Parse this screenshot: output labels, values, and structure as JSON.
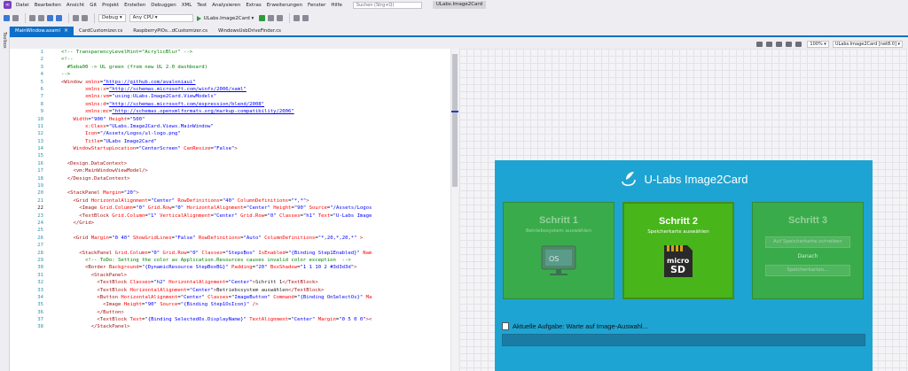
{
  "menu": {
    "items": [
      "Datei",
      "Bearbeiten",
      "Ansicht",
      "Git",
      "Projekt",
      "Erstellen",
      "Debuggen",
      "XML",
      "Test",
      "Analysieren",
      "Extras",
      "Erweiterungen",
      "Fenster",
      "Hilfe"
    ],
    "search_placeholder": "Suchen (Strg+Q)",
    "project_name": "ULabs.Image2Card"
  },
  "toolbar": {
    "config": "Debug",
    "platform": "Any CPU",
    "run_target": "ULabs.Image2Card"
  },
  "toolbox_label": "Toolbox",
  "tabs": [
    {
      "label": "MainWindow.axaml",
      "active": true
    },
    {
      "label": "CardCustomizer.cs",
      "active": false
    },
    {
      "label": "RaspberryPiOs...dCustomizer.cs",
      "active": false
    },
    {
      "label": "WindowsUsbDriveFinder.cs",
      "active": false
    }
  ],
  "designer_toolbar": {
    "zoom": "100%",
    "target": "ULabs.Image2Card [net8.0]"
  },
  "code_lines": [
    {
      "n": "1",
      "segs": [
        [
          "com",
          "<!-- TransparencyLevelHint=\"AcrylicBlur\" -->"
        ]
      ]
    },
    {
      "n": "2",
      "segs": [
        [
          "com",
          "<!--"
        ]
      ]
    },
    {
      "n": "3",
      "segs": [
        [
          "com",
          "  #5eba00 -> UL green (from new UL 2.0 dashboard)"
        ]
      ]
    },
    {
      "n": "4",
      "segs": [
        [
          "com",
          "-->"
        ]
      ]
    },
    {
      "n": "5",
      "segs": [
        [
          "tag",
          "<Window "
        ],
        [
          "attr",
          "xmlns"
        ],
        [
          "txt",
          "="
        ],
        [
          "url",
          "\"https://github.com/avaloniaui\""
        ]
      ]
    },
    {
      "n": "6",
      "segs": [
        [
          "txt",
          "        "
        ],
        [
          "attr",
          "xmlns:x"
        ],
        [
          "txt",
          "="
        ],
        [
          "url",
          "\"http://schemas.microsoft.com/winfx/2006/xaml\""
        ]
      ]
    },
    {
      "n": "7",
      "segs": [
        [
          "txt",
          "        "
        ],
        [
          "attr",
          "xmlns:vm"
        ],
        [
          "txt",
          "="
        ],
        [
          "val",
          "\"using:ULabs.Image2Card.ViewModels\""
        ]
      ]
    },
    {
      "n": "8",
      "segs": [
        [
          "txt",
          "        "
        ],
        [
          "attr",
          "xmlns:d"
        ],
        [
          "txt",
          "="
        ],
        [
          "url",
          "\"http://schemas.microsoft.com/expression/blend/2008\""
        ]
      ]
    },
    {
      "n": "9",
      "segs": [
        [
          "txt",
          "        "
        ],
        [
          "attr",
          "xmlns:mc"
        ],
        [
          "txt",
          "="
        ],
        [
          "url",
          "\"http://schemas.openxmlformats.org/markup-compatibility/2006\""
        ]
      ]
    },
    {
      "n": "10",
      "segs": [
        [
          "txt",
          "    "
        ],
        [
          "attr",
          "Width"
        ],
        [
          "txt",
          "="
        ],
        [
          "val",
          "\"900\""
        ],
        [
          "txt",
          " "
        ],
        [
          "attr",
          "Height"
        ],
        [
          "txt",
          "="
        ],
        [
          "val",
          "\"500\""
        ]
      ]
    },
    {
      "n": "11",
      "segs": [
        [
          "txt",
          "        "
        ],
        [
          "attr",
          "x:Class"
        ],
        [
          "txt",
          "="
        ],
        [
          "val",
          "\"ULabs.Image2Card.Views.MainWindow\""
        ]
      ]
    },
    {
      "n": "12",
      "segs": [
        [
          "txt",
          "        "
        ],
        [
          "attr",
          "Icon"
        ],
        [
          "txt",
          "="
        ],
        [
          "val",
          "\"/Assets/Logos/ul-logo.png\""
        ]
      ]
    },
    {
      "n": "13",
      "segs": [
        [
          "txt",
          "        "
        ],
        [
          "attr",
          "Title"
        ],
        [
          "txt",
          "="
        ],
        [
          "val",
          "\"ULabs Image2Card\""
        ]
      ]
    },
    {
      "n": "14",
      "segs": [
        [
          "txt",
          "    "
        ],
        [
          "attr",
          "WindowStartupLocation"
        ],
        [
          "txt",
          "="
        ],
        [
          "val",
          "\"CenterScreen\""
        ],
        [
          "txt",
          " "
        ],
        [
          "attr",
          "CanResize"
        ],
        [
          "txt",
          "="
        ],
        [
          "val",
          "\"False\""
        ],
        [
          "tag",
          ">"
        ]
      ]
    },
    {
      "n": "15",
      "segs": []
    },
    {
      "n": "16",
      "segs": [
        [
          "txt",
          "  "
        ],
        [
          "tag",
          "<Design.DataContext>"
        ]
      ]
    },
    {
      "n": "17",
      "segs": [
        [
          "txt",
          "    "
        ],
        [
          "tag",
          "<vm:MainWindowViewModel/>"
        ]
      ]
    },
    {
      "n": "18",
      "segs": [
        [
          "txt",
          "  "
        ],
        [
          "tag",
          "</Design.DataContext>"
        ]
      ]
    },
    {
      "n": "19",
      "segs": []
    },
    {
      "n": "20",
      "segs": [
        [
          "txt",
          "  "
        ],
        [
          "tag",
          "<StackPanel "
        ],
        [
          "attr",
          "Margin"
        ],
        [
          "txt",
          "="
        ],
        [
          "val",
          "\"20\""
        ],
        [
          "tag",
          ">"
        ]
      ]
    },
    {
      "n": "21",
      "segs": [
        [
          "txt",
          "    "
        ],
        [
          "tag",
          "<Grid "
        ],
        [
          "attr",
          "HorizontalAlignment"
        ],
        [
          "txt",
          "="
        ],
        [
          "val",
          "\"Center\""
        ],
        [
          "txt",
          " "
        ],
        [
          "attr",
          "RowDefinitions"
        ],
        [
          "txt",
          "="
        ],
        [
          "val",
          "\"40\""
        ],
        [
          "txt",
          " "
        ],
        [
          "attr",
          "ColumnDefinitions"
        ],
        [
          "txt",
          "="
        ],
        [
          "val",
          "\"*,*\""
        ],
        [
          "tag",
          ">"
        ]
      ]
    },
    {
      "n": "22",
      "cur": true,
      "segs": [
        [
          "txt",
          "      "
        ],
        [
          "tag",
          "<Image "
        ],
        [
          "attr",
          "Grid.Column"
        ],
        [
          "txt",
          "="
        ],
        [
          "val",
          "\"0\""
        ],
        [
          "txt",
          " "
        ],
        [
          "attr",
          "Grid.Row"
        ],
        [
          "txt",
          "="
        ],
        [
          "val",
          "\"0\""
        ],
        [
          "txt",
          " "
        ],
        [
          "attr",
          "HorizontalAlignment"
        ],
        [
          "txt",
          "="
        ],
        [
          "val",
          "\"Center\""
        ],
        [
          "txt",
          " "
        ],
        [
          "attr",
          "Height"
        ],
        [
          "txt",
          "="
        ],
        [
          "val",
          "\"90\""
        ],
        [
          "txt",
          " "
        ],
        [
          "attr",
          "Source"
        ],
        [
          "txt",
          "="
        ],
        [
          "val",
          "\"/Assets/Logos"
        ]
      ]
    },
    {
      "n": "23",
      "segs": [
        [
          "txt",
          "      "
        ],
        [
          "tag",
          "<TextBlock "
        ],
        [
          "attr",
          "Grid.Column"
        ],
        [
          "txt",
          "="
        ],
        [
          "val",
          "\"1\""
        ],
        [
          "txt",
          " "
        ],
        [
          "attr",
          "VerticalAlignment"
        ],
        [
          "txt",
          "="
        ],
        [
          "val",
          "\"Center\""
        ],
        [
          "txt",
          " "
        ],
        [
          "attr",
          "Grid.Row"
        ],
        [
          "txt",
          "="
        ],
        [
          "val",
          "\"0\""
        ],
        [
          "txt",
          " "
        ],
        [
          "attr",
          "Classes"
        ],
        [
          "txt",
          "="
        ],
        [
          "val",
          "\"h1\""
        ],
        [
          "txt",
          " "
        ],
        [
          "attr",
          "Text"
        ],
        [
          "txt",
          "="
        ],
        [
          "val",
          "\"U-Labs Image"
        ]
      ]
    },
    {
      "n": "24",
      "segs": [
        [
          "txt",
          "    "
        ],
        [
          "tag",
          "</Grid>"
        ]
      ]
    },
    {
      "n": "25",
      "segs": []
    },
    {
      "n": "26",
      "segs": [
        [
          "txt",
          "    "
        ],
        [
          "tag",
          "<Grid "
        ],
        [
          "attr",
          "Margin"
        ],
        [
          "txt",
          "="
        ],
        [
          "val",
          "\"0 40\""
        ],
        [
          "txt",
          " "
        ],
        [
          "attr",
          "ShowGridLines"
        ],
        [
          "txt",
          "="
        ],
        [
          "val",
          "\"False\""
        ],
        [
          "txt",
          " "
        ],
        [
          "attr",
          "RowDefinitions"
        ],
        [
          "txt",
          "="
        ],
        [
          "val",
          "\"Auto\""
        ],
        [
          "txt",
          " "
        ],
        [
          "attr",
          "ColumnDefinitions"
        ],
        [
          "txt",
          "="
        ],
        [
          "val",
          "\"*,20,*,20,*\""
        ],
        [
          "tag",
          " >"
        ]
      ]
    },
    {
      "n": "27",
      "segs": []
    },
    {
      "n": "28",
      "segs": [
        [
          "txt",
          "      "
        ],
        [
          "tag",
          "<StackPanel "
        ],
        [
          "attr",
          "Grid.Column"
        ],
        [
          "txt",
          "="
        ],
        [
          "val",
          "\"0\""
        ],
        [
          "txt",
          " "
        ],
        [
          "attr",
          "Grid.Row"
        ],
        [
          "txt",
          "="
        ],
        [
          "val",
          "\"0\""
        ],
        [
          "txt",
          " "
        ],
        [
          "attr",
          "Classes"
        ],
        [
          "txt",
          "="
        ],
        [
          "val",
          "\"StepsBox\""
        ],
        [
          "txt",
          " "
        ],
        [
          "attr",
          "IsEnabled"
        ],
        [
          "txt",
          "="
        ],
        [
          "val",
          "\"{Binding Step1Enabled}\""
        ],
        [
          "txt",
          " "
        ],
        [
          "attr",
          "Nam"
        ]
      ]
    },
    {
      "n": "29",
      "segs": [
        [
          "txt",
          "        "
        ],
        [
          "com",
          "<!-- ToDo: Setting the color as Application.Resources causes invalid color exception  -->"
        ]
      ]
    },
    {
      "n": "30",
      "segs": [
        [
          "txt",
          "        "
        ],
        [
          "tag",
          "<Border "
        ],
        [
          "attr",
          "Background"
        ],
        [
          "txt",
          "="
        ],
        [
          "val",
          "\"{DynamicResource StepBoxBG}\""
        ],
        [
          "txt",
          " "
        ],
        [
          "attr",
          "Padding"
        ],
        [
          "txt",
          "="
        ],
        [
          "val",
          "\"20\""
        ],
        [
          "txt",
          " "
        ],
        [
          "attr",
          "BoxShadow"
        ],
        [
          "txt",
          "="
        ],
        [
          "val",
          "\"1 1 10 2 #3d3d3d\""
        ],
        [
          "tag",
          ">"
        ]
      ]
    },
    {
      "n": "31",
      "segs": [
        [
          "txt",
          "          "
        ],
        [
          "tag",
          "<StackPanel>"
        ]
      ]
    },
    {
      "n": "32",
      "segs": [
        [
          "txt",
          "            "
        ],
        [
          "tag",
          "<TextBlock "
        ],
        [
          "attr",
          "Classes"
        ],
        [
          "txt",
          "="
        ],
        [
          "val",
          "\"h2\""
        ],
        [
          "txt",
          " "
        ],
        [
          "attr",
          "HorizontalAlignment"
        ],
        [
          "txt",
          "="
        ],
        [
          "val",
          "\"Center\""
        ],
        [
          "tag",
          ">"
        ],
        [
          "txt",
          "Schritt 1"
        ],
        [
          "tag",
          "</TextBlock>"
        ]
      ]
    },
    {
      "n": "33",
      "segs": [
        [
          "txt",
          "            "
        ],
        [
          "tag",
          "<TextBlock "
        ],
        [
          "attr",
          "HorizontalAlignment"
        ],
        [
          "txt",
          "="
        ],
        [
          "val",
          "\"Center\""
        ],
        [
          "tag",
          ">"
        ],
        [
          "txt",
          "Betriebssystem auswählen"
        ],
        [
          "tag",
          "</TextBlock>"
        ]
      ]
    },
    {
      "n": "34",
      "segs": [
        [
          "txt",
          "            "
        ],
        [
          "tag",
          "<Button "
        ],
        [
          "attr",
          "HorizontalAlignment"
        ],
        [
          "txt",
          "="
        ],
        [
          "val",
          "\"Center\""
        ],
        [
          "txt",
          " "
        ],
        [
          "attr",
          "Classes"
        ],
        [
          "txt",
          "="
        ],
        [
          "val",
          "\"ImageButton\""
        ],
        [
          "txt",
          " "
        ],
        [
          "attr",
          "Command"
        ],
        [
          "txt",
          "="
        ],
        [
          "val",
          "\"{Binding OnSelectOs}\""
        ],
        [
          "txt",
          " "
        ],
        [
          "attr",
          "Ma"
        ]
      ]
    },
    {
      "n": "35",
      "segs": [
        [
          "txt",
          "              "
        ],
        [
          "tag",
          "<Image "
        ],
        [
          "attr",
          "Height"
        ],
        [
          "txt",
          "="
        ],
        [
          "val",
          "\"90\""
        ],
        [
          "txt",
          " "
        ],
        [
          "attr",
          "Source"
        ],
        [
          "txt",
          "="
        ],
        [
          "val",
          "\"{Binding Step1OsIcon}\""
        ],
        [
          "tag",
          " />"
        ]
      ]
    },
    {
      "n": "36",
      "segs": [
        [
          "txt",
          "            "
        ],
        [
          "tag",
          "</Button>"
        ]
      ]
    },
    {
      "n": "37",
      "segs": [
        [
          "txt",
          "            "
        ],
        [
          "tag",
          "<TextBlock "
        ],
        [
          "attr",
          "Text"
        ],
        [
          "txt",
          "="
        ],
        [
          "val",
          "\"{Binding SelectedOs.DisplayName}\""
        ],
        [
          "txt",
          " "
        ],
        [
          "attr",
          "TextAlignment"
        ],
        [
          "txt",
          "="
        ],
        [
          "val",
          "\"Center\""
        ],
        [
          "txt",
          " "
        ],
        [
          "attr",
          "Margin"
        ],
        [
          "txt",
          "="
        ],
        [
          "val",
          "\"0 5 0 0\""
        ],
        [
          "tag",
          "><"
        ]
      ]
    },
    {
      "n": "38",
      "segs": [
        [
          "txt",
          "          "
        ],
        [
          "tag",
          "</StackPanel>"
        ]
      ]
    }
  ],
  "app": {
    "title": "U-Labs Image2Card",
    "steps": [
      {
        "title": "Schritt 1",
        "subtitle": "Betriebssystem auswählen",
        "icon": "os-icon",
        "state": "inactive"
      },
      {
        "title": "Schritt 2",
        "subtitle": "Speicherkarte auswählen",
        "icon": "sd-card-icon",
        "state": "active",
        "sd_label_top": "micro",
        "sd_label_bottom": "SD"
      },
      {
        "title": "Schritt 3",
        "subtitle": "",
        "state": "inactive",
        "button1": "Auf Speicherkarte schreiben",
        "middle": "Danach",
        "button2": "Speicherkarten..."
      }
    ],
    "status_label": "Aktuelle Aufgabe:",
    "status_value": "Warte auf Image-Auswahl...",
    "progress": 0
  },
  "colors": {
    "accent": "#0e6fc8",
    "app_bg": "#1ea4d2",
    "step_bg": "#3aab4a",
    "step_active_bg": "#48b51b"
  }
}
